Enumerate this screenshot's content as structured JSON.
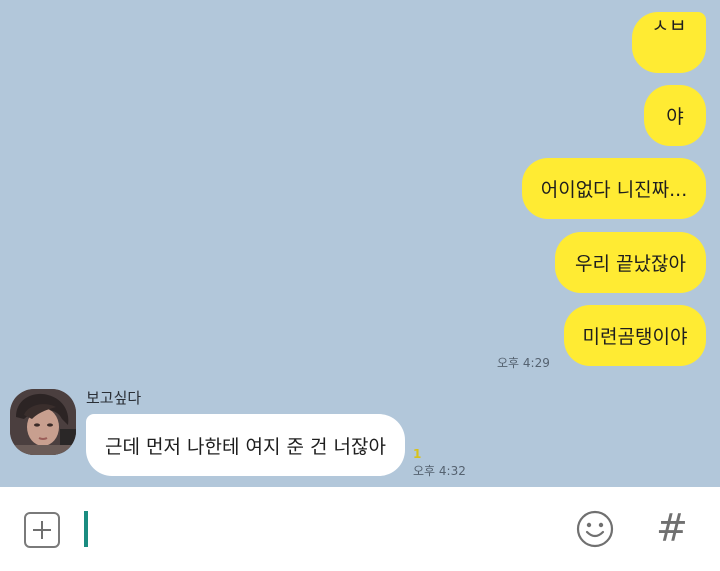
{
  "messages_sent": [
    {
      "text": "ㅅㅂ"
    },
    {
      "text": "야"
    },
    {
      "text": "어이없다 니진짜..."
    },
    {
      "text": "우리 끝났잖아"
    },
    {
      "text": "미련곰탱이야"
    }
  ],
  "sent_time": "오후 4:29",
  "received": {
    "sender": "보고싶다",
    "text": "근데 먼저 나한테 여지 준 건 너잖아",
    "unread_count": "1",
    "time": "오후 4:32"
  },
  "colors": {
    "background": "#b2c7da",
    "my_bubble": "#ffeb33",
    "their_bubble": "#ffffff",
    "cursor": "#1a8c80"
  },
  "icons": {
    "attach": "plus-square-icon",
    "emoji": "smiley-icon",
    "hashtag": "hash-icon"
  },
  "input": {
    "value": "",
    "hashtag_symbol": "#"
  }
}
